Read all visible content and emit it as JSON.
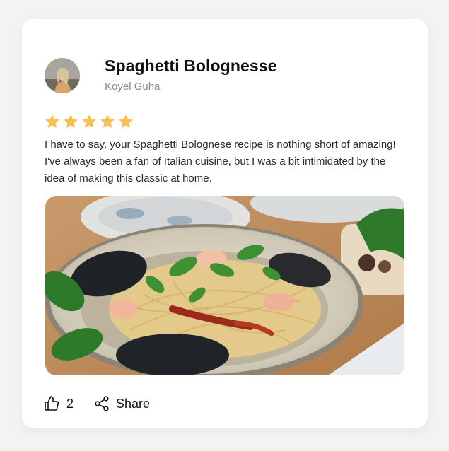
{
  "post": {
    "title": "Spaghetti Bolognesse",
    "author": "Koyel Guha",
    "rating": 5,
    "review": "I have to say, your Spaghetti Bolognese recipe is nothing short of amazing! I've always been a fan of Italian cuisine, but I was a bit intimidated by the idea of making this classic at home."
  },
  "actions": {
    "like_count": "2",
    "share_label": "Share"
  },
  "icons": {
    "like": "thumbs-up-icon",
    "share": "share-icon",
    "star": "star-icon"
  },
  "colors": {
    "star": "#F9BF52",
    "title": "#111111",
    "author": "#8C8C8C",
    "text": "#2A2A2A",
    "card": "#FFFFFF",
    "background": "#F3F3F4"
  }
}
